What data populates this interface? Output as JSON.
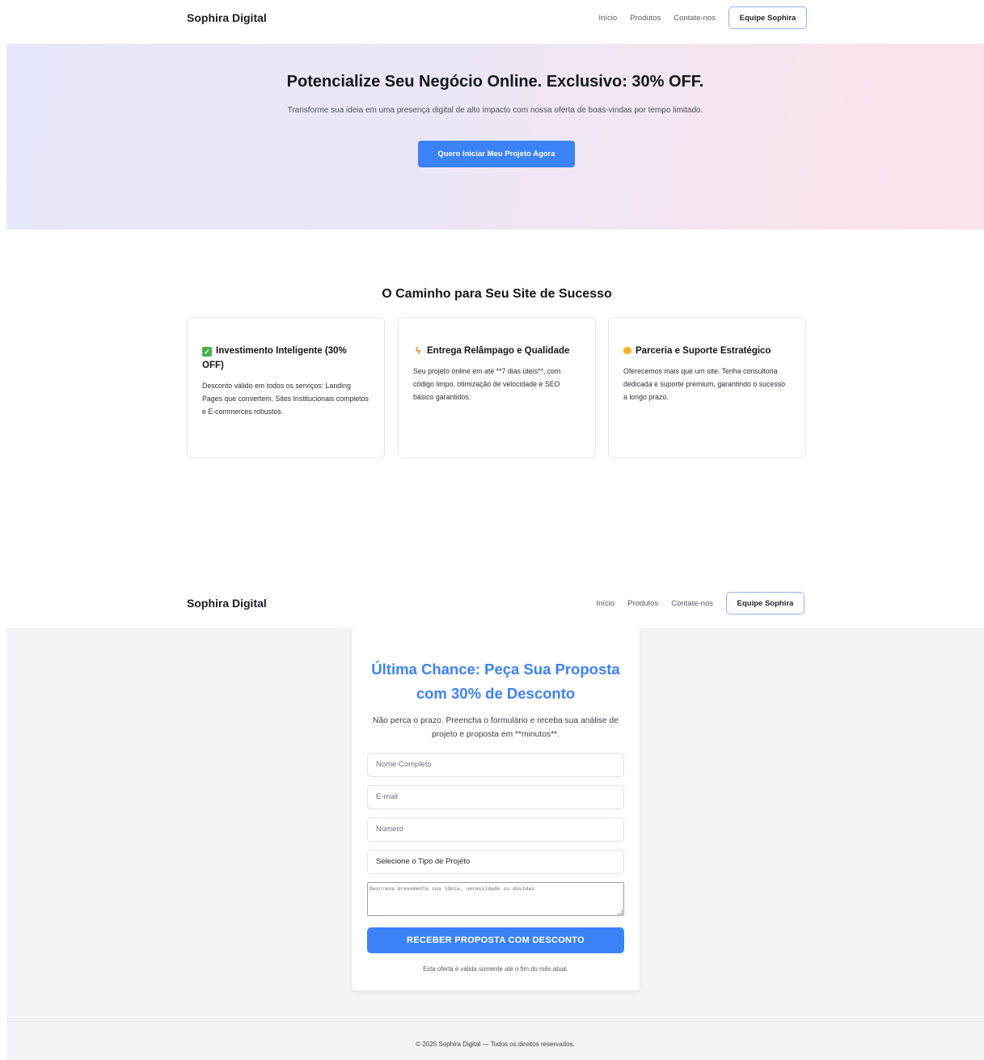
{
  "nav": {
    "brand": "Sophira Digital",
    "links": [
      "Início",
      "Produtos",
      "Contate-nos"
    ],
    "team_button": "Equipe Sophira"
  },
  "hero": {
    "title": "Potencialize Seu Negócio Online. Exclusivo: 30% OFF.",
    "subtitle": "Transforme sua ideia em uma presença digital de alto impacto com nossa oferta de boas-vindas por tempo limitado.",
    "cta": "Quero Iniciar Meu Projeto Agora"
  },
  "features": {
    "title": "O Caminho para Seu Site de Sucesso",
    "cards": [
      {
        "icon": "check-icon",
        "title": "Investimento Inteligente (30% OFF)",
        "text": "Desconto válido em todos os serviços: Landing Pages que convertem, Sites Institucionais completos e E-commerces robustos."
      },
      {
        "icon": "lightning-icon",
        "title": "Entrega Relâmpago e Qualidade",
        "text": "Seu projeto online em até **7 dias úteis**, com código limpo, otimização de velocidade e SEO básico garantidos."
      },
      {
        "icon": "handshake-icon",
        "title": "Parceria e Suporte Estratégico",
        "text": "Oferecemos mais que um site. Tenha consultoria dedicada e suporte premium, garantindo o sucesso a longo prazo."
      }
    ]
  },
  "form": {
    "title": "Última Chance: Peça Sua Proposta com 30% de Desconto",
    "subtitle": "Não perca o prazo. Preencha o formulário e receba sua análise de projeto e proposta em **minutos**.",
    "name_placeholder": "Nome Completo",
    "email_placeholder": "E-mail",
    "phone_placeholder": "Número",
    "project_type_selected": "Selecione o Tipo de Projeto",
    "message_placeholder": "Descreva brevemente sua ideia, necessidade ou dúvidas",
    "submit": "RECEBER PROPOSTA COM DESCONTO",
    "note": "Esta oferta é válida somente até o fim do mês atual."
  },
  "footer": {
    "text": "© 2025 Sophira Digital — Todos os direitos reservados."
  },
  "colors": {
    "accent": "#3b82f6",
    "hero_gradient_start": "#e5e9f9",
    "hero_gradient_end": "#fbe3ea",
    "form_background": "#f3f4f6"
  }
}
